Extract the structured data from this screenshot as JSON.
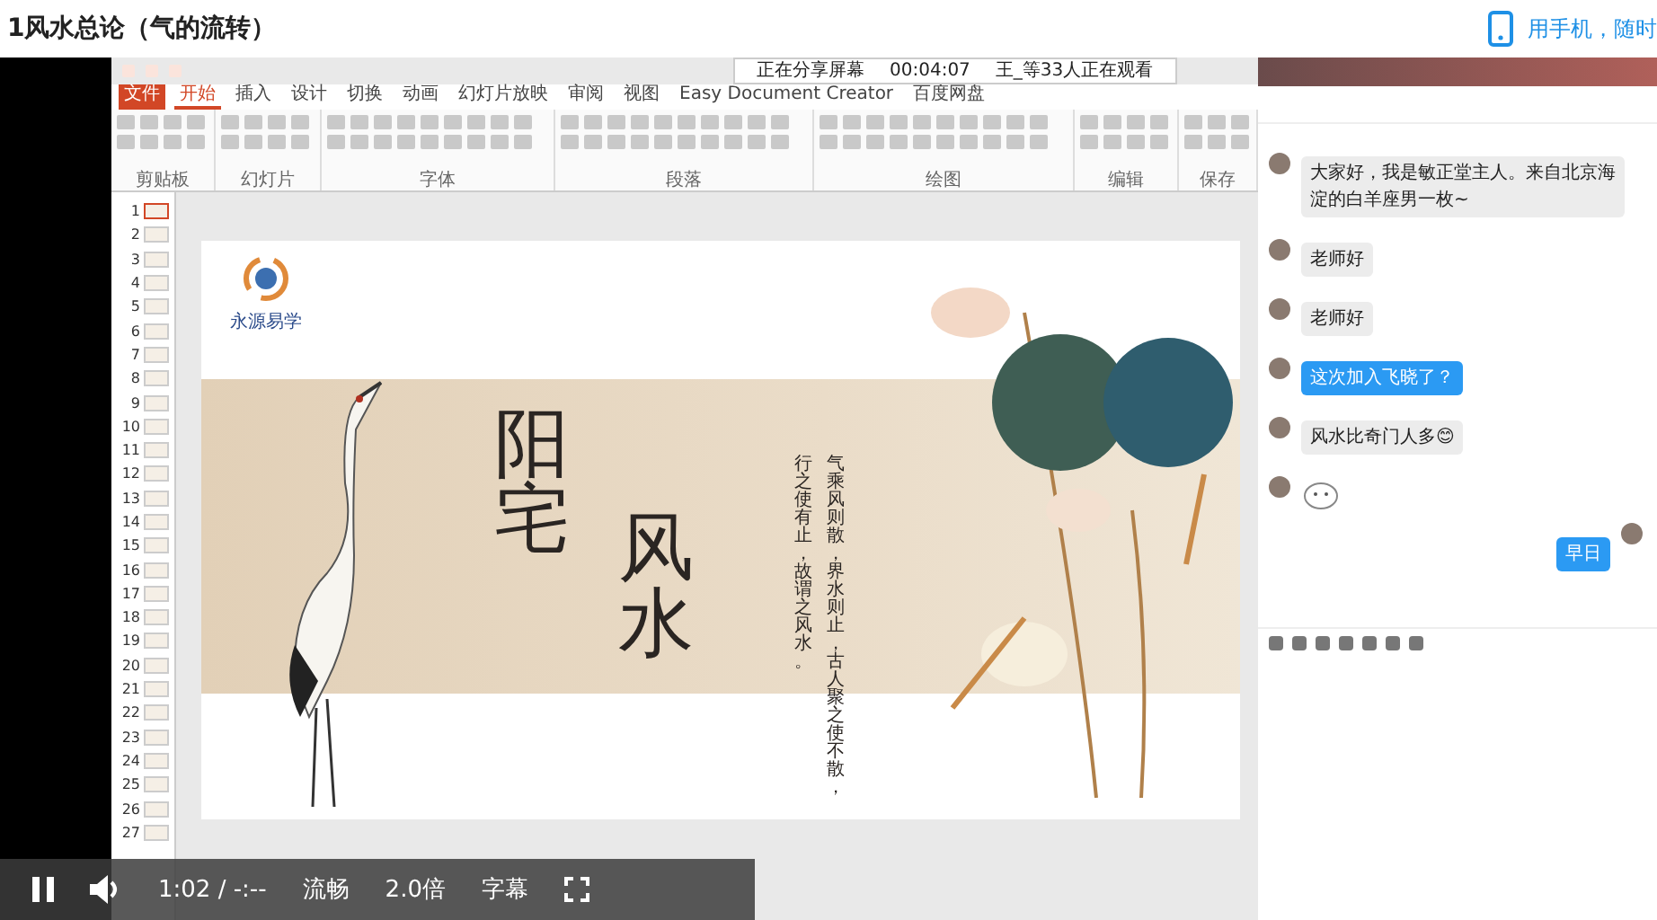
{
  "page": {
    "title": "1风水总论（气的流转）",
    "mobile_link": "用手机，随时"
  },
  "recording": {
    "share_bar": {
      "status": "正在分享屏幕",
      "elapsed": "00:04:07",
      "viewers": "王_等33人正在观看"
    },
    "ribbon_tabs": [
      {
        "label": "文件",
        "selected": false,
        "kind": "file"
      },
      {
        "label": "开始",
        "selected": true,
        "kind": "tab"
      },
      {
        "label": "插入",
        "selected": false,
        "kind": "tab"
      },
      {
        "label": "设计",
        "selected": false,
        "kind": "tab"
      },
      {
        "label": "切换",
        "selected": false,
        "kind": "tab"
      },
      {
        "label": "动画",
        "selected": false,
        "kind": "tab"
      },
      {
        "label": "幻灯片放映",
        "selected": false,
        "kind": "tab"
      },
      {
        "label": "审阅",
        "selected": false,
        "kind": "tab"
      },
      {
        "label": "视图",
        "selected": false,
        "kind": "tab"
      },
      {
        "label": "Easy Document Creator",
        "selected": false,
        "kind": "tab"
      },
      {
        "label": "百度网盘",
        "selected": false,
        "kind": "tab"
      }
    ],
    "ribbon_groups": [
      "剪贴板",
      "幻灯片",
      "字体",
      "段落",
      "绘图",
      "编辑",
      "保存"
    ],
    "slide_numbers": [
      {
        "label": "1",
        "selected": true
      },
      {
        "label": "2",
        "selected": false
      },
      {
        "label": "3",
        "selected": false
      },
      {
        "label": "4",
        "selected": false
      },
      {
        "label": "5",
        "selected": false
      },
      {
        "label": "6",
        "selected": false
      },
      {
        "label": "7",
        "selected": false
      },
      {
        "label": "8",
        "selected": false
      },
      {
        "label": "9",
        "selected": false
      },
      {
        "label": "10",
        "selected": false
      },
      {
        "label": "11",
        "selected": false
      },
      {
        "label": "12",
        "selected": false
      },
      {
        "label": "13",
        "selected": false
      },
      {
        "label": "14",
        "selected": false
      },
      {
        "label": "15",
        "selected": false
      },
      {
        "label": "16",
        "selected": false
      },
      {
        "label": "17",
        "selected": false
      },
      {
        "label": "18",
        "selected": false
      },
      {
        "label": "19",
        "selected": false
      },
      {
        "label": "20",
        "selected": false
      },
      {
        "label": "21",
        "selected": false
      },
      {
        "label": "22",
        "selected": false
      },
      {
        "label": "23",
        "selected": false
      },
      {
        "label": "24",
        "selected": false
      },
      {
        "label": "25",
        "selected": false
      },
      {
        "label": "26",
        "selected": false
      },
      {
        "label": "27",
        "selected": false
      }
    ],
    "slide": {
      "logo_text": "永源易学",
      "title_columns": [
        "阳宅",
        "风水"
      ],
      "verse_columns": [
        "行之使有止，故谓之风水。",
        "气乘风则散，界水则止，古人聚之使不散，"
      ]
    },
    "chat": {
      "messages": [
        {
          "kind": "text",
          "text": "大家好，我是敏正堂主人。来自北京海淀的白羊座男一枚~",
          "highlighted": false
        },
        {
          "kind": "text",
          "text": "老师好",
          "highlighted": false
        },
        {
          "kind": "text",
          "text": "老师好",
          "highlighted": false
        },
        {
          "kind": "text",
          "text": "这次加入飞晓了？",
          "highlighted": true
        },
        {
          "kind": "text",
          "text": "风水比奇门人多😊",
          "highlighted": false
        },
        {
          "kind": "sticker",
          "highlighted": false
        },
        {
          "kind": "own",
          "text": "早日",
          "highlighted": true
        }
      ]
    }
  },
  "player": {
    "playing": true,
    "time": "1:02 / -:--",
    "quality": "流畅",
    "speed": "2.0倍",
    "subtitles": "字幕"
  }
}
